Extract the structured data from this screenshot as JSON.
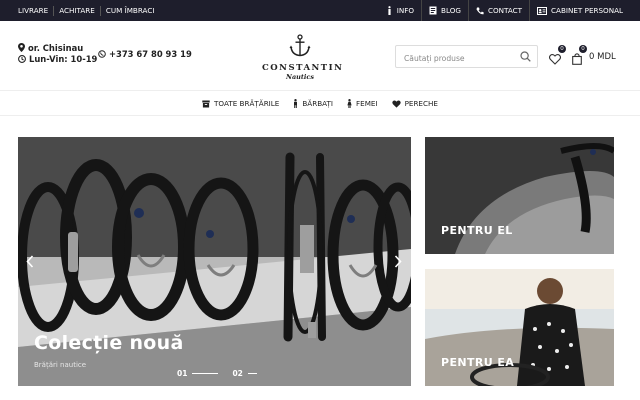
{
  "topbar": {
    "left_links": [
      "LIVRARE",
      "ACHITARE",
      "CUM ÎMBRACI"
    ],
    "right_links": [
      {
        "label": "INFO",
        "icon": "info-icon"
      },
      {
        "label": "BLOG",
        "icon": "blog-icon"
      },
      {
        "label": "CONTACT",
        "icon": "phone-icon"
      },
      {
        "label": "CABINET PERSONAL",
        "icon": "id-card-icon"
      }
    ]
  },
  "header": {
    "address": "or. Chisinau",
    "hours": "Lun-Vin: 10-19",
    "phone": "+373 67 80 93 19",
    "logo_brand": "CONSTANTIN",
    "logo_sub": "Nautics",
    "search_placeholder": "Căutați produse",
    "wishlist_count": "0",
    "cart_count": "0",
    "cart_total": "0 MDL"
  },
  "nav": {
    "items": [
      "TOATE BRĂȚĂRILE",
      "BĂRBAȚI",
      "FEMEI",
      "PERECHE"
    ]
  },
  "hero": {
    "title": "Colecție nouă",
    "subtitle": "Brățări nautice",
    "slides": [
      "01",
      "02"
    ]
  },
  "panels": {
    "men_label": "PENTRU EL",
    "women_label": "PENTRU EA"
  },
  "colors": {
    "topbar_bg": "#1e1e2c",
    "accent": "#1e1e2c"
  }
}
